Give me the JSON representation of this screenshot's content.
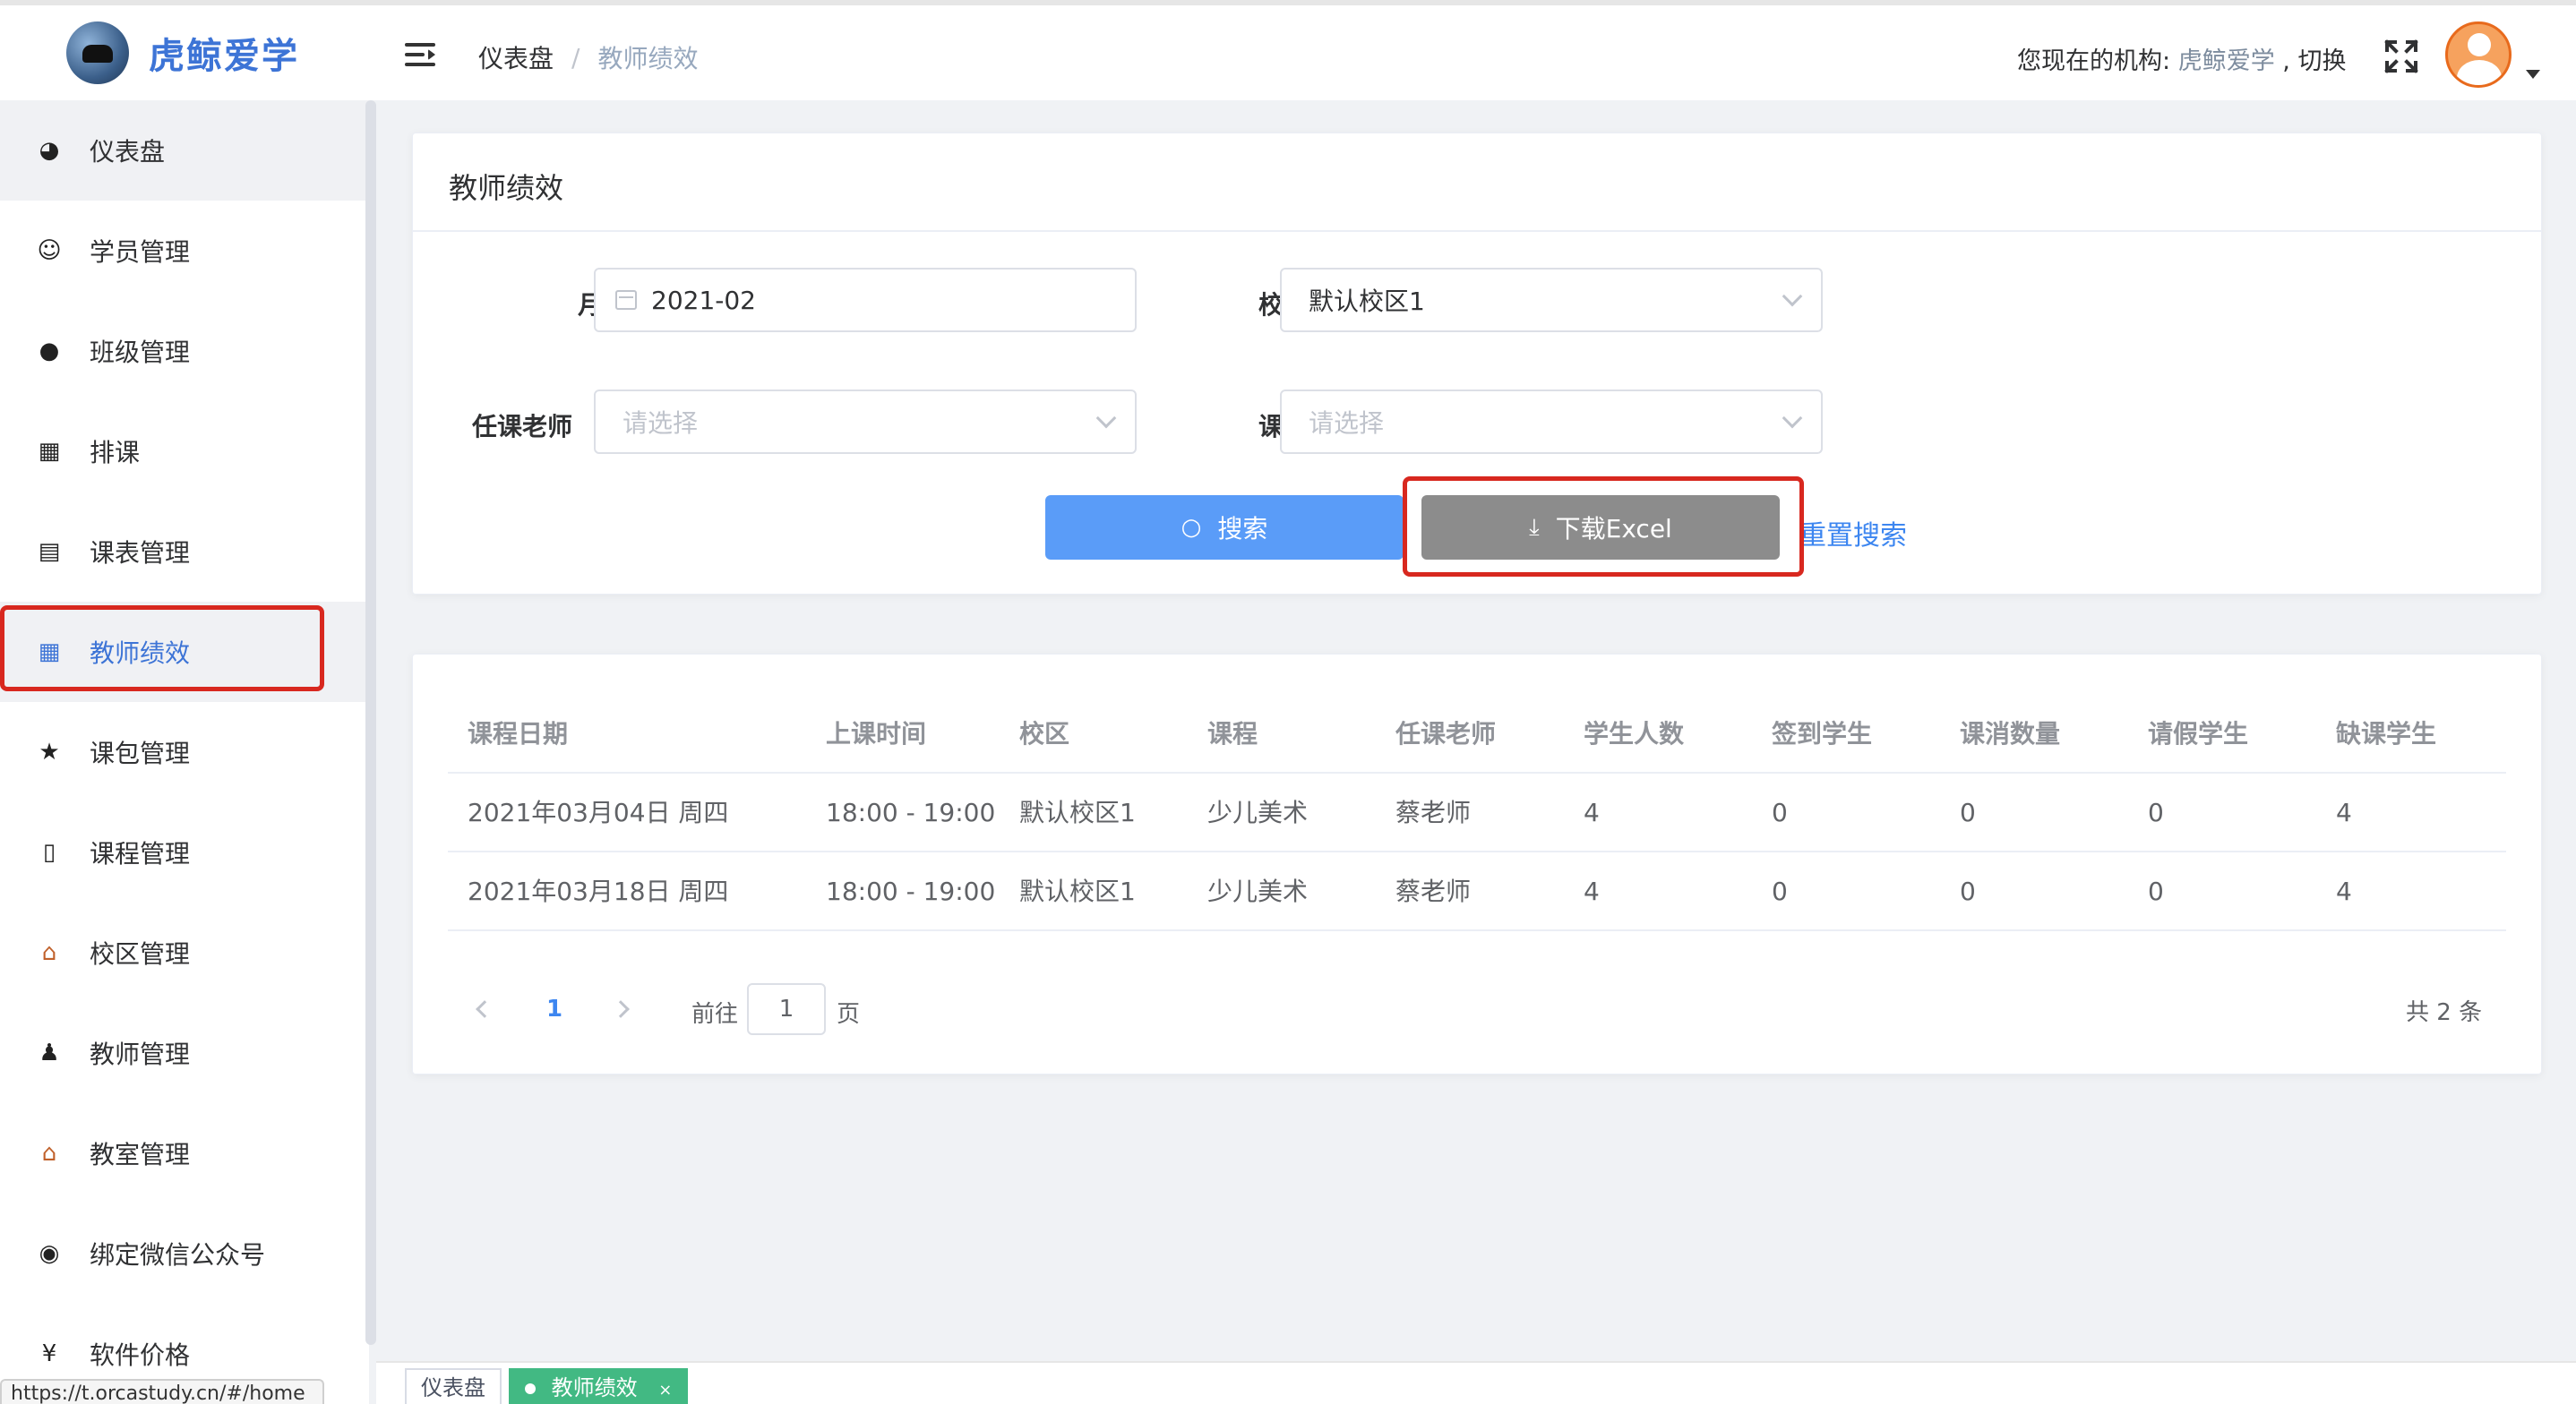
{
  "header": {
    "app_name": "虎鲸爱学",
    "breadcrumb": {
      "home": "仪表盘",
      "separator": "/",
      "current": "教师绩效"
    },
    "org_prefix": "您现在的机构:",
    "org_name": "虎鲸爱学",
    "org_switch": ", 切换"
  },
  "sidebar": {
    "items": [
      {
        "label": "仪表盘",
        "icon": "dashboard-icon"
      },
      {
        "label": "学员管理",
        "icon": "student-icon"
      },
      {
        "label": "班级管理",
        "icon": "users-icon"
      },
      {
        "label": "排课",
        "icon": "calendar-icon"
      },
      {
        "label": "课表管理",
        "icon": "table-icon"
      },
      {
        "label": "教师绩效",
        "icon": "grid-icon"
      },
      {
        "label": "课包管理",
        "icon": "star-icon"
      },
      {
        "label": "课程管理",
        "icon": "book-icon"
      },
      {
        "label": "校区管理",
        "icon": "school-icon"
      },
      {
        "label": "教师管理",
        "icon": "teacher-icon"
      },
      {
        "label": "教室管理",
        "icon": "classroom-icon"
      },
      {
        "label": "绑定微信公众号",
        "icon": "wechat-icon"
      },
      {
        "label": "软件价格",
        "icon": "yen-icon"
      }
    ]
  },
  "filter": {
    "title": "教师绩效",
    "month_label": "月份",
    "month_value": "2021-02",
    "campus_label": "校区",
    "campus_value": "默认校区1",
    "teacher_label": "任课老师",
    "teacher_placeholder": "请选择",
    "course_label": "课程",
    "course_placeholder": "请选择",
    "search_button": "搜索",
    "download_button": "下载Excel",
    "reset_button": "重置搜索"
  },
  "table": {
    "columns": [
      "课程日期",
      "上课时间",
      "校区",
      "课程",
      "任课老师",
      "学生人数",
      "签到学生",
      "课消数量",
      "请假学生",
      "缺课学生"
    ],
    "rows": [
      [
        "2021年03月04日 周四",
        "18:00 - 19:00",
        "默认校区1",
        "少儿美术",
        "蔡老师",
        "4",
        "0",
        "0",
        "0",
        "4"
      ],
      [
        "2021年03月18日 周四",
        "18:00 - 19:00",
        "默认校区1",
        "少儿美术",
        "蔡老师",
        "4",
        "0",
        "0",
        "0",
        "4"
      ]
    ]
  },
  "pagination": {
    "current_page": "1",
    "goto_prefix": "前往",
    "goto_value": "1",
    "goto_suffix": "页",
    "total": "共 2 条"
  },
  "tags": {
    "items": [
      {
        "label": "仪表盘"
      },
      {
        "label": "教师绩效",
        "close": "×"
      }
    ]
  },
  "status_url": "https://t.orcastudy.cn/#/home",
  "colors": {
    "accent": "#3d74d6",
    "primary_button": "#5a9cf8",
    "highlight": "#d8281f",
    "active_tag": "#42b983"
  }
}
